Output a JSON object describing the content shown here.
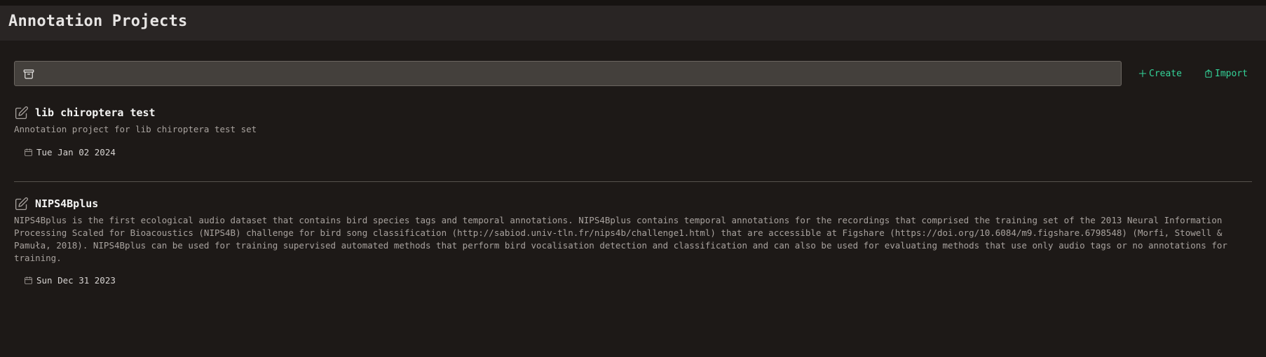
{
  "header": {
    "title": "Annotation Projects"
  },
  "search": {
    "placeholder": "",
    "value": ""
  },
  "actions": {
    "create_label": "Create",
    "import_label": "Import"
  },
  "colors": {
    "accent": "#34d399",
    "background": "#1d1917",
    "header": "#292524",
    "input": "#44403c"
  },
  "projects": [
    {
      "name": "lib chiroptera test",
      "description": "Annotation project for lib chiroptera test set",
      "date": "Tue Jan 02 2024"
    },
    {
      "name": "NIPS4Bplus",
      "description": "NIPS4Bplus is the first ecological audio dataset that contains bird species tags and temporal annotations. NIPS4Bplus contains temporal annotations for the recordings that comprised the training set of the 2013 Neural Information Processing Scaled for Bioacoustics (NIPS4B) challenge for bird song classification (http://sabiod.univ-tln.fr/nips4b/challenge1.html) that are accessible at Figshare (https://doi.org/10.6084/m9.figshare.6798548) (Morfi, Stowell & Pamuła, 2018). NIPS4Bplus can be used for training supervised automated methods that perform bird vocalisation detection and classification and can also be used for evaluating methods that use only audio tags or no annotations for training.",
      "date": "Sun Dec 31 2023"
    }
  ]
}
